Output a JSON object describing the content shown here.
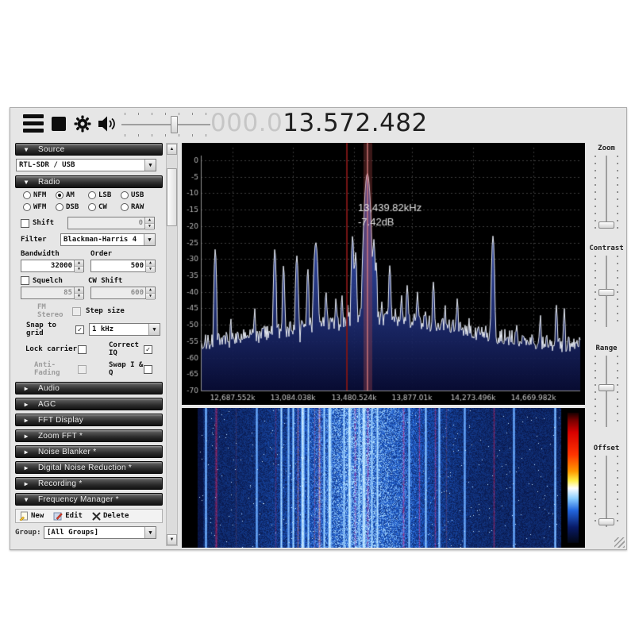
{
  "toolbar": {
    "frequency_dim": "000.0",
    "frequency_main": "13.572.482"
  },
  "sidebar": {
    "source": {
      "label": "Source",
      "device": "RTL-SDR / USB"
    },
    "radio": {
      "label": "Radio",
      "modes": [
        {
          "label": "NFM",
          "selected": false
        },
        {
          "label": "AM",
          "selected": true
        },
        {
          "label": "LSB",
          "selected": false
        },
        {
          "label": "USB",
          "selected": false
        },
        {
          "label": "WFM",
          "selected": false
        },
        {
          "label": "DSB",
          "selected": false
        },
        {
          "label": "CW",
          "selected": false
        },
        {
          "label": "RAW",
          "selected": false
        }
      ],
      "shift": {
        "label": "Shift",
        "checked": false,
        "value": "0"
      },
      "filter": {
        "label": "Filter",
        "value": "Blackman-Harris 4"
      },
      "bandwidth": {
        "label": "Bandwidth",
        "value": "32000"
      },
      "order": {
        "label": "Order",
        "value": "500"
      },
      "squelch": {
        "label": "Squelch",
        "checked": false,
        "value": "85"
      },
      "cw_shift": {
        "label": "CW Shift",
        "value": "600"
      },
      "fm_stereo": {
        "label": "FM Stereo",
        "checked": false
      },
      "step_size_label": "Step size",
      "snap": {
        "label": "Snap to grid",
        "checked": true,
        "value": "1 kHz"
      },
      "lock_carrier": {
        "label": "Lock carrier",
        "checked": false
      },
      "correct_iq": {
        "label": "Correct IQ",
        "checked": true
      },
      "anti_fading": {
        "label": "Anti-Fading",
        "checked": false
      },
      "swap_iq": {
        "label": "Swap I & Q",
        "checked": false
      }
    },
    "panels": [
      {
        "label": "Audio"
      },
      {
        "label": "AGC"
      },
      {
        "label": "FFT Display"
      },
      {
        "label": "Zoom FFT *"
      },
      {
        "label": "Noise Blanker *"
      },
      {
        "label": "Digital Noise Reduction *"
      },
      {
        "label": "Recording *"
      },
      {
        "label": "Frequency Manager *"
      }
    ],
    "freq_manager": {
      "new_label": "New",
      "edit_label": "Edit",
      "delete_label": "Delete",
      "group_label": "Group:",
      "group_value": "[All Groups]"
    }
  },
  "right_panel": {
    "sliders": [
      {
        "label": "Zoom"
      },
      {
        "label": "Contrast"
      },
      {
        "label": "Range"
      },
      {
        "label": "Offset"
      }
    ]
  },
  "chart_data": {
    "spectrum": {
      "type": "line",
      "title": "FFT spectrum",
      "db_ticks": [
        0,
        -5,
        -10,
        -15,
        -20,
        -25,
        -30,
        -35,
        -40,
        -45,
        -50,
        -55,
        -60,
        -65,
        -70
      ],
      "ylim": [
        -70,
        0
      ],
      "freq_labels": [
        "12,687.552k",
        "13,084.038k",
        "13,480.524k",
        "13,877.01k",
        "14,273.496k",
        "14,669.982k"
      ],
      "label_fracs": [
        0.0837,
        0.2427,
        0.4038,
        0.5565,
        0.7176,
        0.8766
      ],
      "tooltip_line1": "13,439.82kHz",
      "tooltip_line2": "-7.42dB",
      "marker_frac": 0.385,
      "tune_frac": 0.4393,
      "noise_floor_db": -56.5,
      "center_rise_db": 8.5,
      "peaks": [
        [
          0.038,
          -27,
          1.3
        ],
        [
          0.079,
          -48,
          1.2
        ],
        [
          0.142,
          -45,
          1.2
        ],
        [
          0.195,
          -27,
          1.4
        ],
        [
          0.218,
          -32,
          1.3
        ],
        [
          0.253,
          -29,
          1.5
        ],
        [
          0.282,
          -33,
          1.3
        ],
        [
          0.303,
          -25,
          2.2
        ],
        [
          0.33,
          -40,
          1.4
        ],
        [
          0.356,
          -42,
          1.3
        ],
        [
          0.372,
          -41,
          1.3
        ],
        [
          0.387,
          -44,
          1.2
        ],
        [
          0.4,
          -23,
          1.4
        ],
        [
          0.408,
          -28,
          1.3
        ],
        [
          0.42,
          -45,
          1.2
        ],
        [
          0.439,
          -4,
          3.0
        ],
        [
          0.448,
          -38,
          1.3
        ],
        [
          0.456,
          -24,
          1.4
        ],
        [
          0.462,
          -31,
          1.3
        ],
        [
          0.477,
          -43,
          1.2
        ],
        [
          0.498,
          -32,
          1.4
        ],
        [
          0.513,
          -45,
          1.2
        ],
        [
          0.529,
          -41,
          1.3
        ],
        [
          0.544,
          -38,
          1.4
        ],
        [
          0.571,
          -40,
          1.3
        ],
        [
          0.592,
          -46,
          1.2
        ],
        [
          0.613,
          -37,
          1.4
        ],
        [
          0.644,
          -44,
          1.2
        ],
        [
          0.676,
          -42,
          1.3
        ],
        [
          0.707,
          -48,
          1.2
        ],
        [
          0.77,
          -23,
          1.5
        ],
        [
          0.833,
          -50,
          1.2
        ],
        [
          0.895,
          -47,
          1.2
        ],
        [
          0.937,
          -44,
          1.4
        ],
        [
          0.958,
          -45,
          1.2
        ]
      ]
    },
    "waterfall": {
      "type": "heatmap",
      "wash": {
        "center": 0.45,
        "sigma": 0.2,
        "amp": 0.38
      },
      "stripes": [
        [
          0.022,
          "white",
          0.35
        ],
        [
          0.05,
          "red",
          0.8
        ],
        [
          0.104,
          "gray",
          0.4
        ],
        [
          0.161,
          "white",
          0.3
        ],
        [
          0.213,
          "red",
          0.45
        ],
        [
          0.23,
          "white",
          0.6
        ],
        [
          0.248,
          "white",
          0.4
        ],
        [
          0.261,
          "white",
          0.6
        ],
        [
          0.276,
          "yellow",
          0.7
        ],
        [
          0.289,
          "white",
          0.9
        ],
        [
          0.304,
          "white",
          0.6
        ],
        [
          0.32,
          "yellow",
          0.5
        ],
        [
          0.333,
          "yellow",
          0.9
        ],
        [
          0.348,
          "white",
          0.6
        ],
        [
          0.363,
          "white",
          0.9
        ],
        [
          0.402,
          "white",
          0.6
        ],
        [
          0.417,
          "white",
          0.9
        ],
        [
          0.433,
          "red",
          0.85
        ],
        [
          0.443,
          "white",
          0.5
        ],
        [
          0.457,
          "white",
          0.95
        ],
        [
          0.467,
          "red",
          0.9
        ],
        [
          0.478,
          "white",
          0.6
        ],
        [
          0.493,
          "white",
          0.7
        ],
        [
          0.565,
          "red",
          0.8
        ],
        [
          0.58,
          "white",
          0.5
        ],
        [
          0.609,
          "red",
          0.75
        ],
        [
          0.626,
          "white",
          0.5
        ],
        [
          0.652,
          "red",
          0.7
        ],
        [
          0.663,
          "white",
          0.45
        ],
        [
          0.683,
          "gray",
          0.5
        ],
        [
          0.733,
          "white",
          0.3
        ],
        [
          0.815,
          "red",
          0.7
        ],
        [
          0.87,
          "white",
          0.3
        ],
        [
          0.983,
          "white",
          0.4
        ]
      ]
    }
  }
}
